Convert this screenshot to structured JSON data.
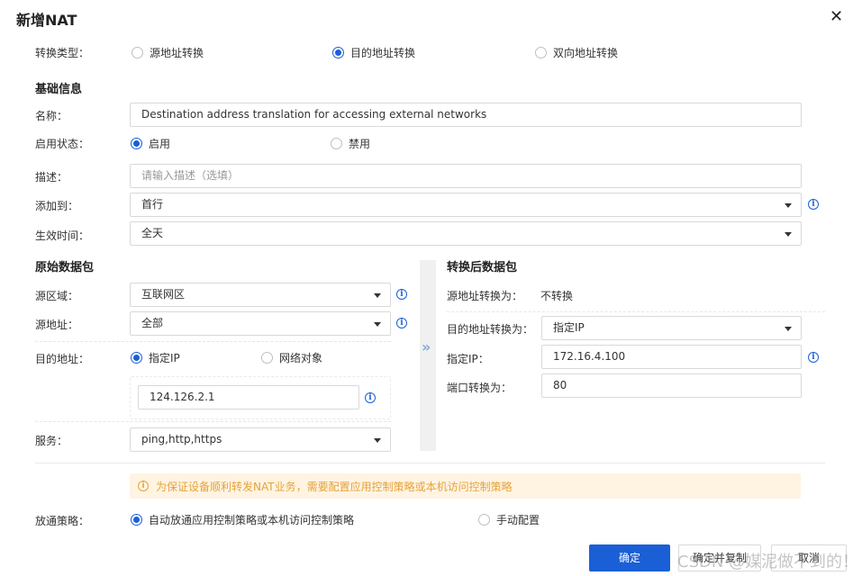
{
  "dialog": {
    "title": "新增NAT",
    "close_label": "✕"
  },
  "conversion_type": {
    "label": "转换类型：",
    "options": [
      {
        "label": "源地址转换",
        "selected": false
      },
      {
        "label": "目的地址转换",
        "selected": true
      },
      {
        "label": "双向地址转换",
        "selected": false
      }
    ]
  },
  "basic": {
    "title": "基础信息",
    "name_label": "名称：",
    "name_value": "Destination address translation for accessing external networks",
    "status_label": "启用状态：",
    "status_options": [
      {
        "label": "启用",
        "selected": true
      },
      {
        "label": "禁用",
        "selected": false
      }
    ],
    "desc_label": "描述：",
    "desc_placeholder": "请输入描述（选填）",
    "add_to_label": "添加到：",
    "add_to_value": "首行",
    "effective_label": "生效时间：",
    "effective_value": "全天"
  },
  "original": {
    "title": "原始数据包",
    "src_zone_label": "源区域：",
    "src_zone_value": "互联网区",
    "src_addr_label": "源地址：",
    "src_addr_value": "全部",
    "dst_addr_label": "目的地址：",
    "dst_options": [
      {
        "label": "指定IP",
        "selected": true
      },
      {
        "label": "网络对象",
        "selected": false
      }
    ],
    "dst_ip_value": "124.126.2.1",
    "service_label": "服务：",
    "service_value": "ping,http,https"
  },
  "translated": {
    "title": "转换后数据包",
    "src_conv_label": "源地址转换为：",
    "src_conv_value": "不转换",
    "dst_conv_label": "目的地址转换为：",
    "dst_conv_value": "指定IP",
    "ip_label": "指定IP：",
    "ip_value": "172.16.4.100",
    "port_label": "端口转换为：",
    "port_value": "80"
  },
  "notice": {
    "text": "为保证设备顺利转发NAT业务，需要配置应用控制策略或本机访问控制策略"
  },
  "policy": {
    "label": "放通策略：",
    "options": [
      {
        "label": "自动放通应用控制策略或本机访问控制策略",
        "selected": true
      },
      {
        "label": "手动配置",
        "selected": false
      }
    ]
  },
  "buttons": {
    "confirm": "确定",
    "confirm_copy": "确定并复制",
    "cancel": "取消"
  },
  "watermark": "CSDN @媒泥做不到的！",
  "colors": {
    "primary": "#1a5fd6",
    "warning": "#e6a23c",
    "warning_bg": "#fff4e2"
  }
}
